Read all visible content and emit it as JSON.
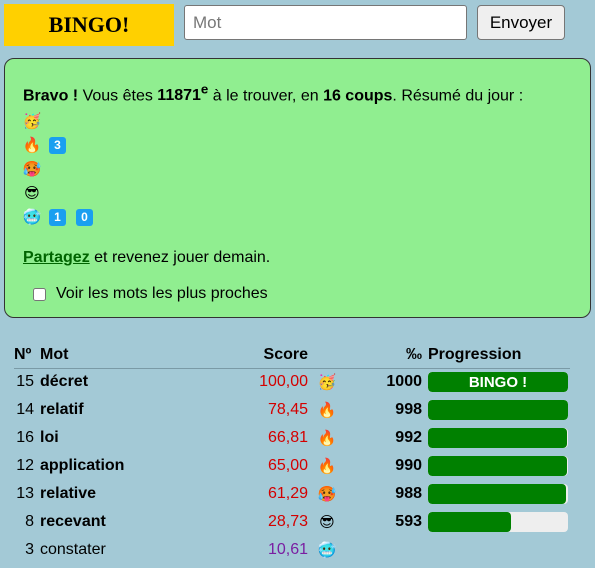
{
  "header": {
    "bingo_label": "BINGO!",
    "input_placeholder": "Mot",
    "send_label": "Envoyer"
  },
  "summary": {
    "bravo": "Bravo !",
    "text1": " Vous êtes ",
    "rank": "11871",
    "rank_sup": "e",
    "text2": " à le trouver, en ",
    "tries": "16 coups",
    "text3": ". Résumé du jour :",
    "emoji_rows": [
      {
        "emoji": "🥳",
        "icon": "party-face-icon",
        "counts": []
      },
      {
        "emoji": "🔥",
        "icon": "fire-icon",
        "counts": [
          "3"
        ]
      },
      {
        "emoji": "🥵",
        "icon": "hot-face-icon",
        "counts": []
      },
      {
        "emoji": "😎",
        "icon": "sunglasses-face-icon",
        "counts": []
      },
      {
        "emoji": "🥶",
        "icon": "cold-face-icon",
        "counts": [
          "1",
          "0"
        ]
      }
    ],
    "share_link": "Partagez",
    "share_text": " et revenez jouer demain.",
    "closest_label": "Voir les mots les plus proches"
  },
  "table": {
    "headers": {
      "num": "Nº",
      "word": "Mot",
      "score": "Score",
      "permille": "‰",
      "progress": "Progression"
    },
    "rows": [
      {
        "num": "15",
        "word": "décret",
        "bold": true,
        "score": "100,00",
        "score_color": "#d40000",
        "emoji": "🥳",
        "icon": "party-face-icon",
        "permille": "1000",
        "progress": 1.0,
        "bar_label": "BINGO !"
      },
      {
        "num": "14",
        "word": "relatif",
        "bold": true,
        "score": "78,45",
        "score_color": "#d40000",
        "emoji": "🔥",
        "icon": "fire-icon",
        "permille": "998",
        "progress": 0.998,
        "bar_label": ""
      },
      {
        "num": "16",
        "word": "loi",
        "bold": true,
        "score": "66,81",
        "score_color": "#d40000",
        "emoji": "🔥",
        "icon": "fire-icon",
        "permille": "992",
        "progress": 0.992,
        "bar_label": ""
      },
      {
        "num": "12",
        "word": "application",
        "bold": true,
        "score": "65,00",
        "score_color": "#d40000",
        "emoji": "🔥",
        "icon": "fire-icon",
        "permille": "990",
        "progress": 0.99,
        "bar_label": ""
      },
      {
        "num": "13",
        "word": "relative",
        "bold": true,
        "score": "61,29",
        "score_color": "#d40000",
        "emoji": "🥵",
        "icon": "hot-face-icon",
        "permille": "988",
        "progress": 0.988,
        "bar_label": ""
      },
      {
        "num": "8",
        "word": "recevant",
        "bold": true,
        "score": "28,73",
        "score_color": "#d40000",
        "emoji": "😎",
        "icon": "sunglasses-face-icon",
        "permille": "593",
        "progress": 0.593,
        "bar_label": ""
      },
      {
        "num": "3",
        "word": "constater",
        "bold": false,
        "score": "10,61",
        "score_color": "#7a1fa2",
        "emoji": "🥶",
        "icon": "cold-face-icon",
        "permille": "",
        "progress": null,
        "bar_label": ""
      }
    ]
  },
  "colors": {
    "bingo_yellow": "#ffd000",
    "panel_green": "#90ee90",
    "bar_green": "#008000",
    "badge_blue": "#1a9ff0",
    "background": "#a3c9d6"
  }
}
